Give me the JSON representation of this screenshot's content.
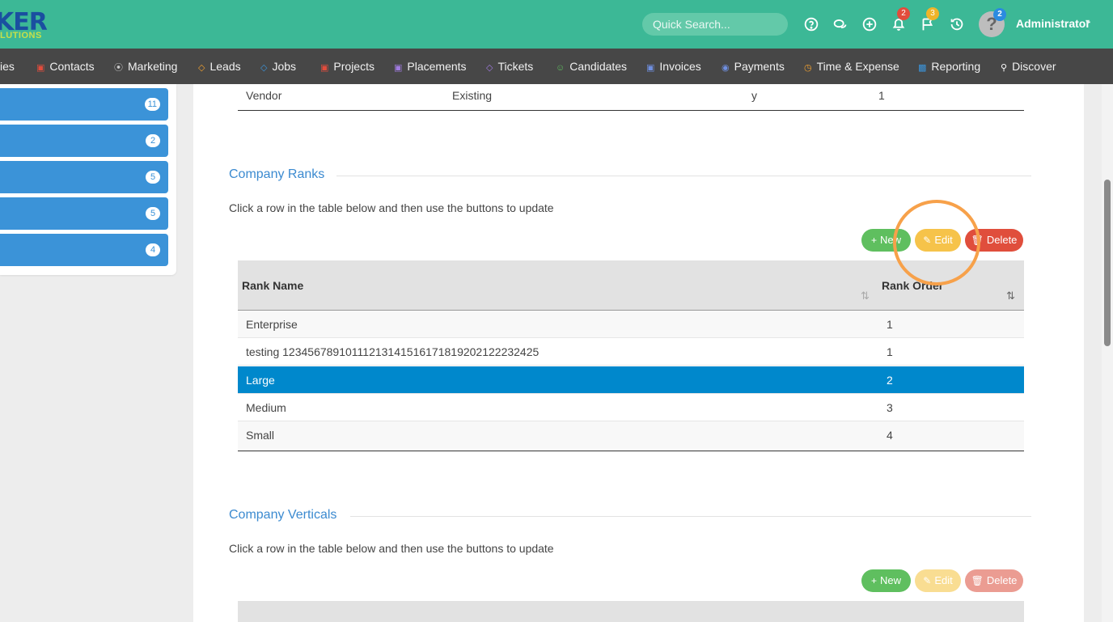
{
  "header": {
    "logo_top": "KER",
    "logo_bottom": "LUTIONS",
    "search_placeholder": "Quick Search...",
    "notifications_count": "2",
    "flags_count": "3",
    "avatar_count": "2",
    "user_name": "Administrator",
    "icons": [
      "help-circle-icon",
      "chat-icon",
      "plus-circle-icon",
      "bell-icon",
      "flag-icon",
      "history-icon"
    ]
  },
  "nav": {
    "items": [
      {
        "label": "ies"
      },
      {
        "label": "Contacts",
        "icon": "contacts-icon",
        "color": "#e24c3c"
      },
      {
        "label": "Marketing",
        "icon": "broadcast-icon",
        "color": "#cccccc"
      },
      {
        "label": "Leads",
        "icon": "leads-icon",
        "color": "#f0a030"
      },
      {
        "label": "Jobs",
        "icon": "jobs-icon",
        "color": "#3b93d8"
      },
      {
        "label": "Projects",
        "icon": "projects-icon",
        "color": "#e24c3c"
      },
      {
        "label": "Placements",
        "icon": "placements-icon",
        "color": "#a07be0"
      },
      {
        "label": "Tickets",
        "icon": "tickets-icon",
        "color": "#a07be0"
      },
      {
        "label": "Candidates",
        "icon": "candidates-icon",
        "color": "#5fbf5f"
      },
      {
        "label": "Invoices",
        "icon": "invoices-icon",
        "color": "#6f8fe0"
      },
      {
        "label": "Payments",
        "icon": "payments-icon",
        "color": "#6f8fe0"
      },
      {
        "label": "Time & Expense",
        "icon": "clock-icon",
        "color": "#f0a030"
      },
      {
        "label": "Reporting",
        "icon": "bar-chart-icon",
        "color": "#3b93d8"
      },
      {
        "label": "Discover",
        "icon": "search-icon",
        "color": "#ffffff"
      }
    ]
  },
  "left_panel": {
    "counts": [
      "11",
      "2",
      "5",
      "5",
      "4"
    ]
  },
  "prev_table": {
    "row": {
      "c1": "Vendor",
      "c2": "Existing",
      "c3": "y",
      "c4": "1"
    }
  },
  "ranks": {
    "title": "Company Ranks",
    "description": "Click a row in the table below and then use the buttons to update",
    "buttons": {
      "new": "New",
      "edit": "Edit",
      "delete": "Delete"
    },
    "columns": {
      "name": "Rank Name",
      "order": "Rank Order"
    },
    "rows": [
      {
        "name": "Enterprise",
        "order": "1"
      },
      {
        "name": "testing 12345678910111213141516171819202122232425",
        "order": "1"
      },
      {
        "name": "Large",
        "order": "2"
      },
      {
        "name": "Medium",
        "order": "3"
      },
      {
        "name": "Small",
        "order": "4"
      }
    ]
  },
  "verticals": {
    "title": "Company Verticals",
    "description": "Click a row in the table below and then use the buttons to update",
    "buttons": {
      "new": "New",
      "edit": "Edit",
      "delete": "Delete"
    }
  }
}
